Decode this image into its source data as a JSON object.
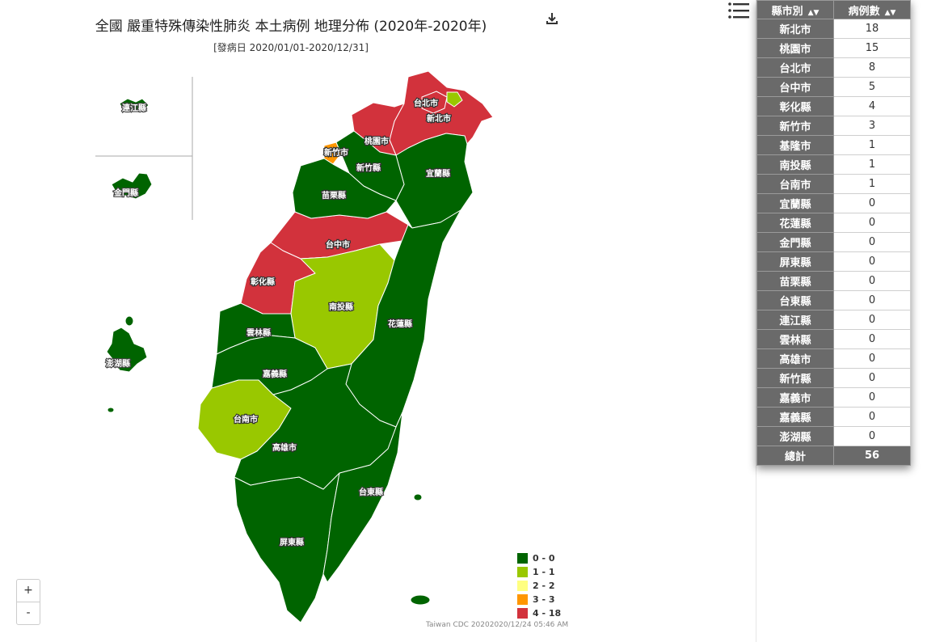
{
  "header": {
    "title": "全國 嚴重特殊傳染性肺炎 本土病例 地理分佈 (2020年-2020年)",
    "subtitle": "[發病日 2020/01/01-2020/12/31]",
    "download_icon": "download-icon",
    "menu_icon": "hamburger-menu-icon"
  },
  "map": {
    "regions": [
      {
        "name": "新北市",
        "cases": 18
      },
      {
        "name": "桃園市",
        "cases": 15
      },
      {
        "name": "台北市",
        "cases": 8
      },
      {
        "name": "台中市",
        "cases": 5
      },
      {
        "name": "彰化縣",
        "cases": 4
      },
      {
        "name": "新竹市",
        "cases": 3
      },
      {
        "name": "基隆市",
        "cases": 1
      },
      {
        "name": "南投縣",
        "cases": 1
      },
      {
        "name": "台南市",
        "cases": 1
      },
      {
        "name": "宜蘭縣",
        "cases": 0
      },
      {
        "name": "花蓮縣",
        "cases": 0
      },
      {
        "name": "金門縣",
        "cases": 0
      },
      {
        "name": "屏東縣",
        "cases": 0
      },
      {
        "name": "苗栗縣",
        "cases": 0
      },
      {
        "name": "台東縣",
        "cases": 0
      },
      {
        "name": "連江縣",
        "cases": 0
      },
      {
        "name": "雲林縣",
        "cases": 0
      },
      {
        "name": "高雄市",
        "cases": 0
      },
      {
        "name": "新竹縣",
        "cases": 0
      },
      {
        "name": "嘉義市",
        "cases": 0
      },
      {
        "name": "嘉義縣",
        "cases": 0
      },
      {
        "name": "澎湖縣",
        "cases": 0
      }
    ]
  },
  "legend": [
    {
      "label": "0 - 0",
      "color": "#006400"
    },
    {
      "label": "1 - 1",
      "color": "#99c800"
    },
    {
      "label": "2 - 2",
      "color": "#ffff80"
    },
    {
      "label": "3 - 3",
      "color": "#ff9600"
    },
    {
      "label": "4 - 18",
      "color": "#d2323c"
    }
  ],
  "credit": "Taiwan CDC 20202020/12/24 05:46 AM",
  "zoom": {
    "in": "+",
    "out": "-"
  },
  "table": {
    "col_county": "縣市別",
    "col_cases": "病例數",
    "sort_icon": "sort-icon",
    "rows": [
      {
        "county": "新北市",
        "cases": "18"
      },
      {
        "county": "桃園市",
        "cases": "15"
      },
      {
        "county": "台北市",
        "cases": "8"
      },
      {
        "county": "台中市",
        "cases": "5"
      },
      {
        "county": "彰化縣",
        "cases": "4"
      },
      {
        "county": "新竹市",
        "cases": "3"
      },
      {
        "county": "基隆市",
        "cases": "1"
      },
      {
        "county": "南投縣",
        "cases": "1"
      },
      {
        "county": "台南市",
        "cases": "1"
      },
      {
        "county": "宜蘭縣",
        "cases": "0"
      },
      {
        "county": "花蓮縣",
        "cases": "0"
      },
      {
        "county": "金門縣",
        "cases": "0"
      },
      {
        "county": "屏東縣",
        "cases": "0"
      },
      {
        "county": "苗栗縣",
        "cases": "0"
      },
      {
        "county": "台東縣",
        "cases": "0"
      },
      {
        "county": "連江縣",
        "cases": "0"
      },
      {
        "county": "雲林縣",
        "cases": "0"
      },
      {
        "county": "高雄市",
        "cases": "0"
      },
      {
        "county": "新竹縣",
        "cases": "0"
      },
      {
        "county": "嘉義市",
        "cases": "0"
      },
      {
        "county": "嘉義縣",
        "cases": "0"
      },
      {
        "county": "澎湖縣",
        "cases": "0"
      }
    ],
    "total_label": "總計",
    "total_value": "56"
  }
}
